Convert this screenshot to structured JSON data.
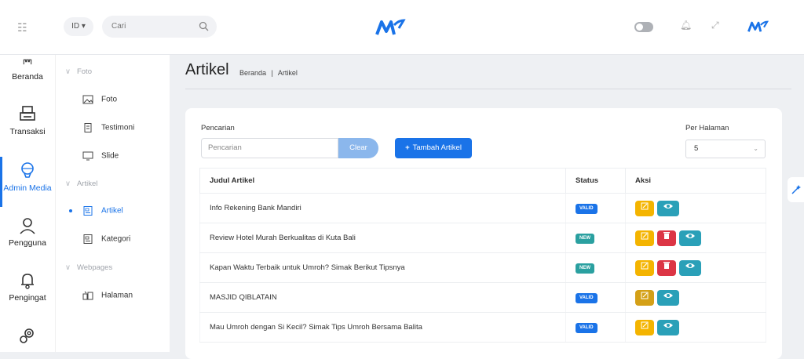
{
  "topbar": {
    "lang": "ID",
    "search_placeholder": "Cari",
    "colors": {
      "brand": "#1a73e8"
    }
  },
  "rail": [
    {
      "label": "Beranda",
      "icon": "home-icon"
    },
    {
      "label": "Transaksi",
      "icon": "printer-icon"
    },
    {
      "label": "Admin Media",
      "icon": "balloon-icon",
      "active": true
    },
    {
      "label": "Pengguna",
      "icon": "user-icon"
    },
    {
      "label": "Pengingat",
      "icon": "bell-icon"
    },
    {
      "label": "",
      "icon": "gears-icon"
    }
  ],
  "submenu": {
    "foto_section": "Foto",
    "foto": "Foto",
    "testimoni": "Testimoni",
    "slide": "Slide",
    "artikel_section": "Artikel",
    "artikel": "Artikel",
    "kategori": "Kategori",
    "webpages_section": "Webpages",
    "halaman": "Halaman"
  },
  "page": {
    "title": "Artikel",
    "breadcrumb_home": "Beranda",
    "breadcrumb_sep": "|",
    "breadcrumb_current": "Artikel"
  },
  "filters": {
    "search_label": "Pencarian",
    "search_placeholder": "Pencarian",
    "clear_label": "Clear",
    "add_label": "Tambah Artikel",
    "per_page_label": "Per Halaman",
    "per_page_value": "5"
  },
  "table": {
    "headers": [
      "Judul Artikel",
      "Status",
      "Aksi"
    ],
    "rows": [
      {
        "title": "Info Rekening Bank Mandiri",
        "status": "VALID"
      },
      {
        "title": "Review Hotel Murah Berkualitas di Kuta Bali",
        "status": "NEW"
      },
      {
        "title": "Kapan Waktu Terbaik untuk Umroh? Simak Berikut Tipsnya",
        "status": "NEW"
      },
      {
        "title": "MASJID QIBLATAIN",
        "status": "VALID"
      },
      {
        "title": "Mau Umroh dengan Si Kecil? Simak Tips Umroh Bersama Balita",
        "status": "VALID"
      }
    ]
  }
}
